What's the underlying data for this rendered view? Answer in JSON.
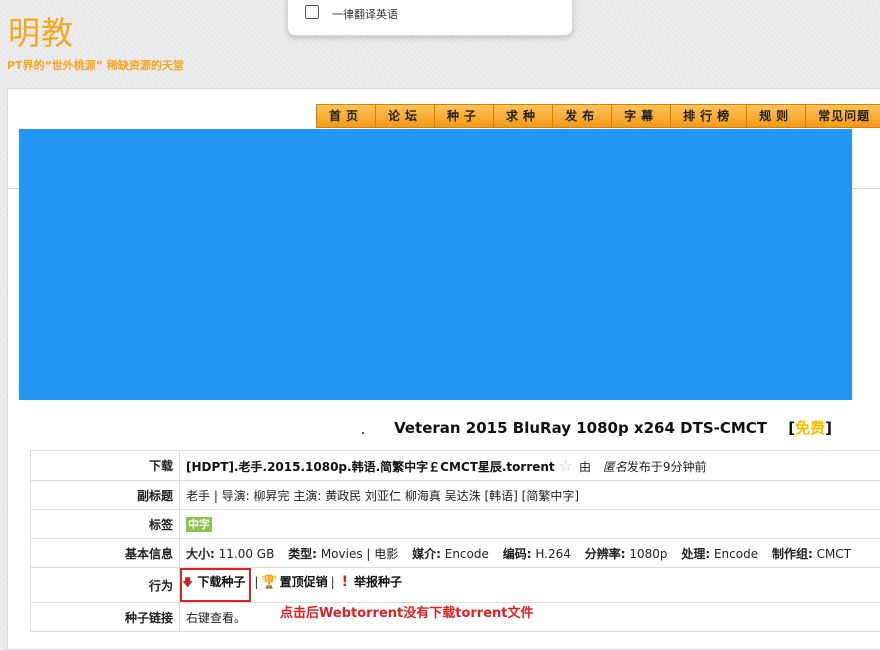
{
  "site": {
    "logo": "明教",
    "slogan": "PT界的“世外桃源” 稀缺资源的天堂"
  },
  "translate_popup": {
    "label": "一律翻译英语"
  },
  "nav": {
    "items": [
      "首页",
      "论坛",
      "种子",
      "求种",
      "发布",
      "字幕",
      "排行榜",
      "规则",
      "常见问题"
    ]
  },
  "torrent": {
    "title": "Veteran 2015 BluRay 1080p x264 DTS-CMCT",
    "free_open": "[",
    "free": "免费",
    "free_close": "]"
  },
  "rows": {
    "download": {
      "key": "下载",
      "link": "[HDPT].老手.2015.1080p.韩语.简繁中字￡CMCT星辰.torrent",
      "by_prefix": "由",
      "uploader": "匿名",
      "time": "发布于9分钟前"
    },
    "subtitle": {
      "key": "副标题",
      "value": "老手 | 导演: 柳昇完 主演: 黄政民 刘亚仁 柳海真 吴达洙 [韩语] [简繁中字]"
    },
    "tags": {
      "key": "标签",
      "tag": "中字"
    },
    "basic": {
      "key": "基本信息",
      "items": [
        {
          "label": "大小:",
          "value": "11.00 GB"
        },
        {
          "label": "类型:",
          "value": "Movies | 电影"
        },
        {
          "label": "媒介:",
          "value": "Encode"
        },
        {
          "label": "编码:",
          "value": "H.264"
        },
        {
          "label": "分辨率:",
          "value": "1080p"
        },
        {
          "label": "处理:",
          "value": "Encode"
        },
        {
          "label": "制作组:",
          "value": "CMCT"
        }
      ]
    },
    "actions": {
      "key": "行为",
      "download_label": "下载种子",
      "sep": "|",
      "promote_label": "置顶促销",
      "report_label": "举报种子"
    },
    "torrent_link": {
      "key": "种子链接",
      "value": "右键查看。"
    }
  },
  "annotation": "点击后Webtorrent没有下载torrent文件",
  "colors": {
    "accent_orange": "#f5a623",
    "nav_orange": "#f39a16",
    "blue_block": "#2196f3",
    "annotation_red": "#e02020",
    "tag_green": "#8bc34a",
    "free_yellow": "#f5c000"
  },
  "icons": {
    "download": "arrow-down-icon",
    "promote": "trophy-icon",
    "report": "exclamation-icon",
    "bookmark": "star-icon"
  }
}
